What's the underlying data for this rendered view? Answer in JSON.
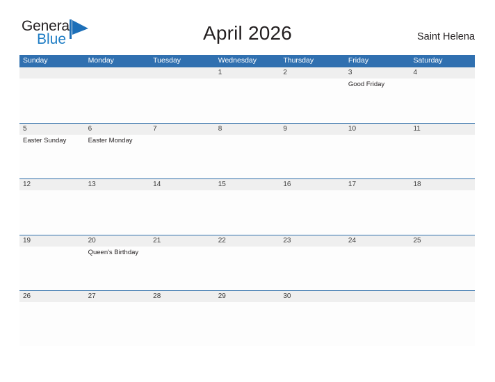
{
  "brand": {
    "name_part1": "General",
    "name_part2": "Blue",
    "flag_icon": "blue-flag-triangle",
    "color_dark": "#231f20",
    "color_blue": "#1d7cc4"
  },
  "header": {
    "title": "April 2026",
    "region": "Saint Helena"
  },
  "theme": {
    "header_blue": "#3070b0",
    "row_line_blue": "#2c6ca8",
    "date_band_gray": "#efefef",
    "page_background": "#ffffff"
  },
  "calendar": {
    "month": "April",
    "year": "2026",
    "weekdays": [
      "Sunday",
      "Monday",
      "Tuesday",
      "Wednesday",
      "Thursday",
      "Friday",
      "Saturday"
    ],
    "weeks": [
      {
        "days": [
          {
            "date": "",
            "event": ""
          },
          {
            "date": "",
            "event": ""
          },
          {
            "date": "",
            "event": ""
          },
          {
            "date": "1",
            "event": ""
          },
          {
            "date": "2",
            "event": ""
          },
          {
            "date": "3",
            "event": "Good Friday"
          },
          {
            "date": "4",
            "event": ""
          }
        ]
      },
      {
        "days": [
          {
            "date": "5",
            "event": "Easter Sunday"
          },
          {
            "date": "6",
            "event": "Easter Monday"
          },
          {
            "date": "7",
            "event": ""
          },
          {
            "date": "8",
            "event": ""
          },
          {
            "date": "9",
            "event": ""
          },
          {
            "date": "10",
            "event": ""
          },
          {
            "date": "11",
            "event": ""
          }
        ]
      },
      {
        "days": [
          {
            "date": "12",
            "event": ""
          },
          {
            "date": "13",
            "event": ""
          },
          {
            "date": "14",
            "event": ""
          },
          {
            "date": "15",
            "event": ""
          },
          {
            "date": "16",
            "event": ""
          },
          {
            "date": "17",
            "event": ""
          },
          {
            "date": "18",
            "event": ""
          }
        ]
      },
      {
        "days": [
          {
            "date": "19",
            "event": ""
          },
          {
            "date": "20",
            "event": "Queen's Birthday"
          },
          {
            "date": "21",
            "event": ""
          },
          {
            "date": "22",
            "event": ""
          },
          {
            "date": "23",
            "event": ""
          },
          {
            "date": "24",
            "event": ""
          },
          {
            "date": "25",
            "event": ""
          }
        ]
      },
      {
        "days": [
          {
            "date": "26",
            "event": ""
          },
          {
            "date": "27",
            "event": ""
          },
          {
            "date": "28",
            "event": ""
          },
          {
            "date": "29",
            "event": ""
          },
          {
            "date": "30",
            "event": ""
          },
          {
            "date": "",
            "event": ""
          },
          {
            "date": "",
            "event": ""
          }
        ]
      }
    ]
  }
}
